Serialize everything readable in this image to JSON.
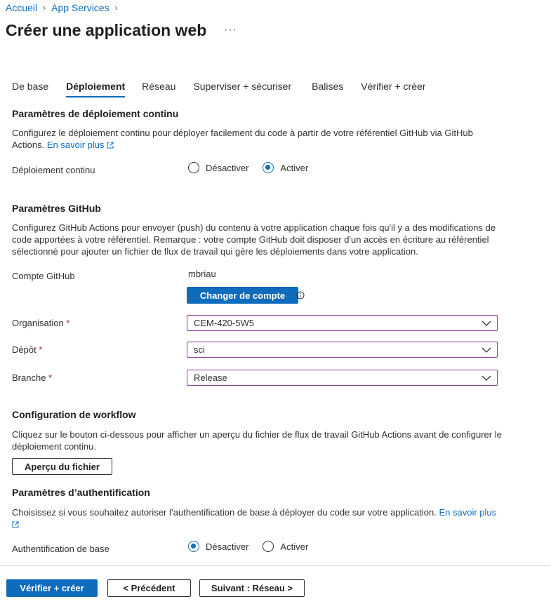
{
  "breadcrumb": [
    "Accueil",
    "App Services"
  ],
  "page_title": "Créer une application web",
  "more_label": "···",
  "tabs": [
    {
      "label": "De base"
    },
    {
      "label": "Déploiement"
    },
    {
      "label": "Réseau"
    },
    {
      "label": "Superviser + sécuriser"
    },
    {
      "label": "Balises"
    },
    {
      "label": "Vérifier + créer"
    }
  ],
  "active_tab": "Déploiement",
  "cd": {
    "heading": "Paramètres de déploiement continu",
    "description": "Configurez le déploiement continu pour déployer facilement du code à partir de votre référentiel GitHub via GitHub Actions.",
    "learn_more": "En savoir plus",
    "label": "Déploiement continu",
    "options": [
      "Désactiver",
      "Activer"
    ],
    "selected": "Activer"
  },
  "github": {
    "heading": "Paramètres GitHub",
    "description": "Configurez GitHub Actions pour envoyer (push) du contenu à votre application chaque fois qu'il y a des modifications de code apportées à votre référentiel. Remarque : votre compte GitHub doit disposer d'un accès en écriture au référentiel sélectionné pour ajouter un fichier de flux de travail qui gère les déploiements dans votre application.",
    "account_label": "Compte GitHub",
    "account_value": "mbriau",
    "change_account": "Changer de compte",
    "org_label": "Organisation",
    "org_value": "CEM-420-5W5",
    "repo_label": "Dépôt",
    "repo_value": "sci",
    "branch_label": "Branche",
    "branch_value": "Release",
    "required_mark": "*"
  },
  "workflow": {
    "heading": "Configuration de workflow",
    "description": "Cliquez sur le bouton ci-dessous pour afficher un aperçu du fichier de flux de travail GitHub Actions avant de configurer le déploiement continu.",
    "preview_button": "Aperçu du fichier"
  },
  "auth": {
    "heading": "Paramètres d’authentification",
    "description": "Choisissez si vous souhaitez autoriser l’authentification de base à déployer du code sur votre application.",
    "learn_more": "En savoir plus",
    "label": "Authentification de base",
    "options": [
      "Désactiver",
      "Activer"
    ],
    "selected": "Désactiver"
  },
  "footer": {
    "review_create": "Vérifier + créer",
    "previous": "< Précédent",
    "next": "Suivant : Réseau >"
  },
  "colors": {
    "accent": "#0f6cbd",
    "required": "#a4262c",
    "select_border": "#8a3a9a"
  }
}
